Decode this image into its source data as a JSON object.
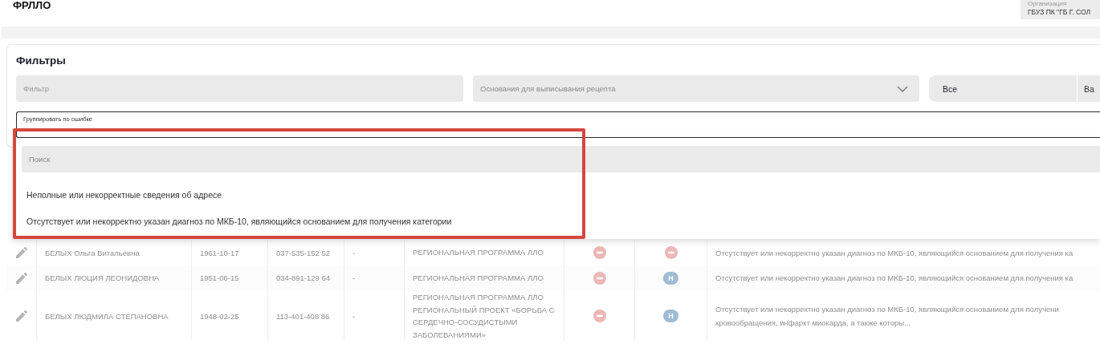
{
  "header": {
    "title": "ФРЛЛО",
    "organization": {
      "label": "Организация",
      "value": "ГБУЗ ПК \"ГБ Г. СОЛ"
    }
  },
  "filters": {
    "title": "Фильтры",
    "filter_field": {
      "placeholder": "Фильтр"
    },
    "basis_select": {
      "placeholder": "Основания для выписывания рецепта"
    },
    "segments": [
      {
        "label": "Все",
        "selected": true
      },
      {
        "label": "Ва",
        "selected": false
      }
    ],
    "group_select": {
      "label": "Группировать по ошибке",
      "expanded": true
    }
  },
  "dropdown": {
    "search": {
      "placeholder": "Поиск"
    },
    "options": [
      "Неполные или некорректные сведения об адресе",
      "Отсутствует или некорректно указан диагноз по МКБ-10, являющийся основанием для получения категории"
    ],
    "highlighted": true
  },
  "table": {
    "rows": [
      {
        "name": "БЕЛЫХ Ольга Витальевна",
        "birth_date": "1961-10-17",
        "snils": "037-535-152 52",
        "column_5": "-",
        "programs": [
          "РЕГИОНАЛЬНАЯ ПРОГРАММА ЛЛО"
        ],
        "status_1": {
          "kind": "minus"
        },
        "status_2": {
          "kind": "minus"
        },
        "error": [
          "Отсутствует или некорректно указан диагноз по МКБ-10, являющийся основанием для получения ка"
        ]
      },
      {
        "name": "БЕЛЫХ ЛЮЦИЯ ЛЕОНИДОВНА",
        "birth_date": "1951-06-15",
        "snils": "034-891-129 64",
        "column_5": "-",
        "programs": [
          "РЕГИОНАЛЬНАЯ ПРОГРАММА ЛЛО"
        ],
        "status_1": {
          "kind": "minus"
        },
        "status_2": {
          "kind": "letter",
          "text": "Н"
        },
        "error": [
          "Отсутствует или некорректно указан диагноз по МКБ-10, являющийся основанием для получения ка"
        ]
      },
      {
        "name": "БЕЛЫХ ЛЮДМИЛА СТЕПАНОВНА",
        "birth_date": "1948-02-25",
        "snils": "113-401-408 86",
        "column_5": "-",
        "programs": [
          "РЕГИОНАЛЬНАЯ ПРОГРАММА ЛЛО",
          "РЕГИОНАЛЬНЫЙ ПРОЕКТ «БОРЬБА С СЕРДЕЧНО-СОСУДИСТЫМИ ЗАБОЛЕВАНИЯМИ»"
        ],
        "status_1": {
          "kind": "minus"
        },
        "status_2": {
          "kind": "letter",
          "text": "Н"
        },
        "error": [
          "Отсутствует или некорректно указан диагноз по МКБ-10, являющийся основанием для получени",
          "кровообращения, инфаркт миокарда, а также которы..."
        ]
      }
    ]
  }
}
